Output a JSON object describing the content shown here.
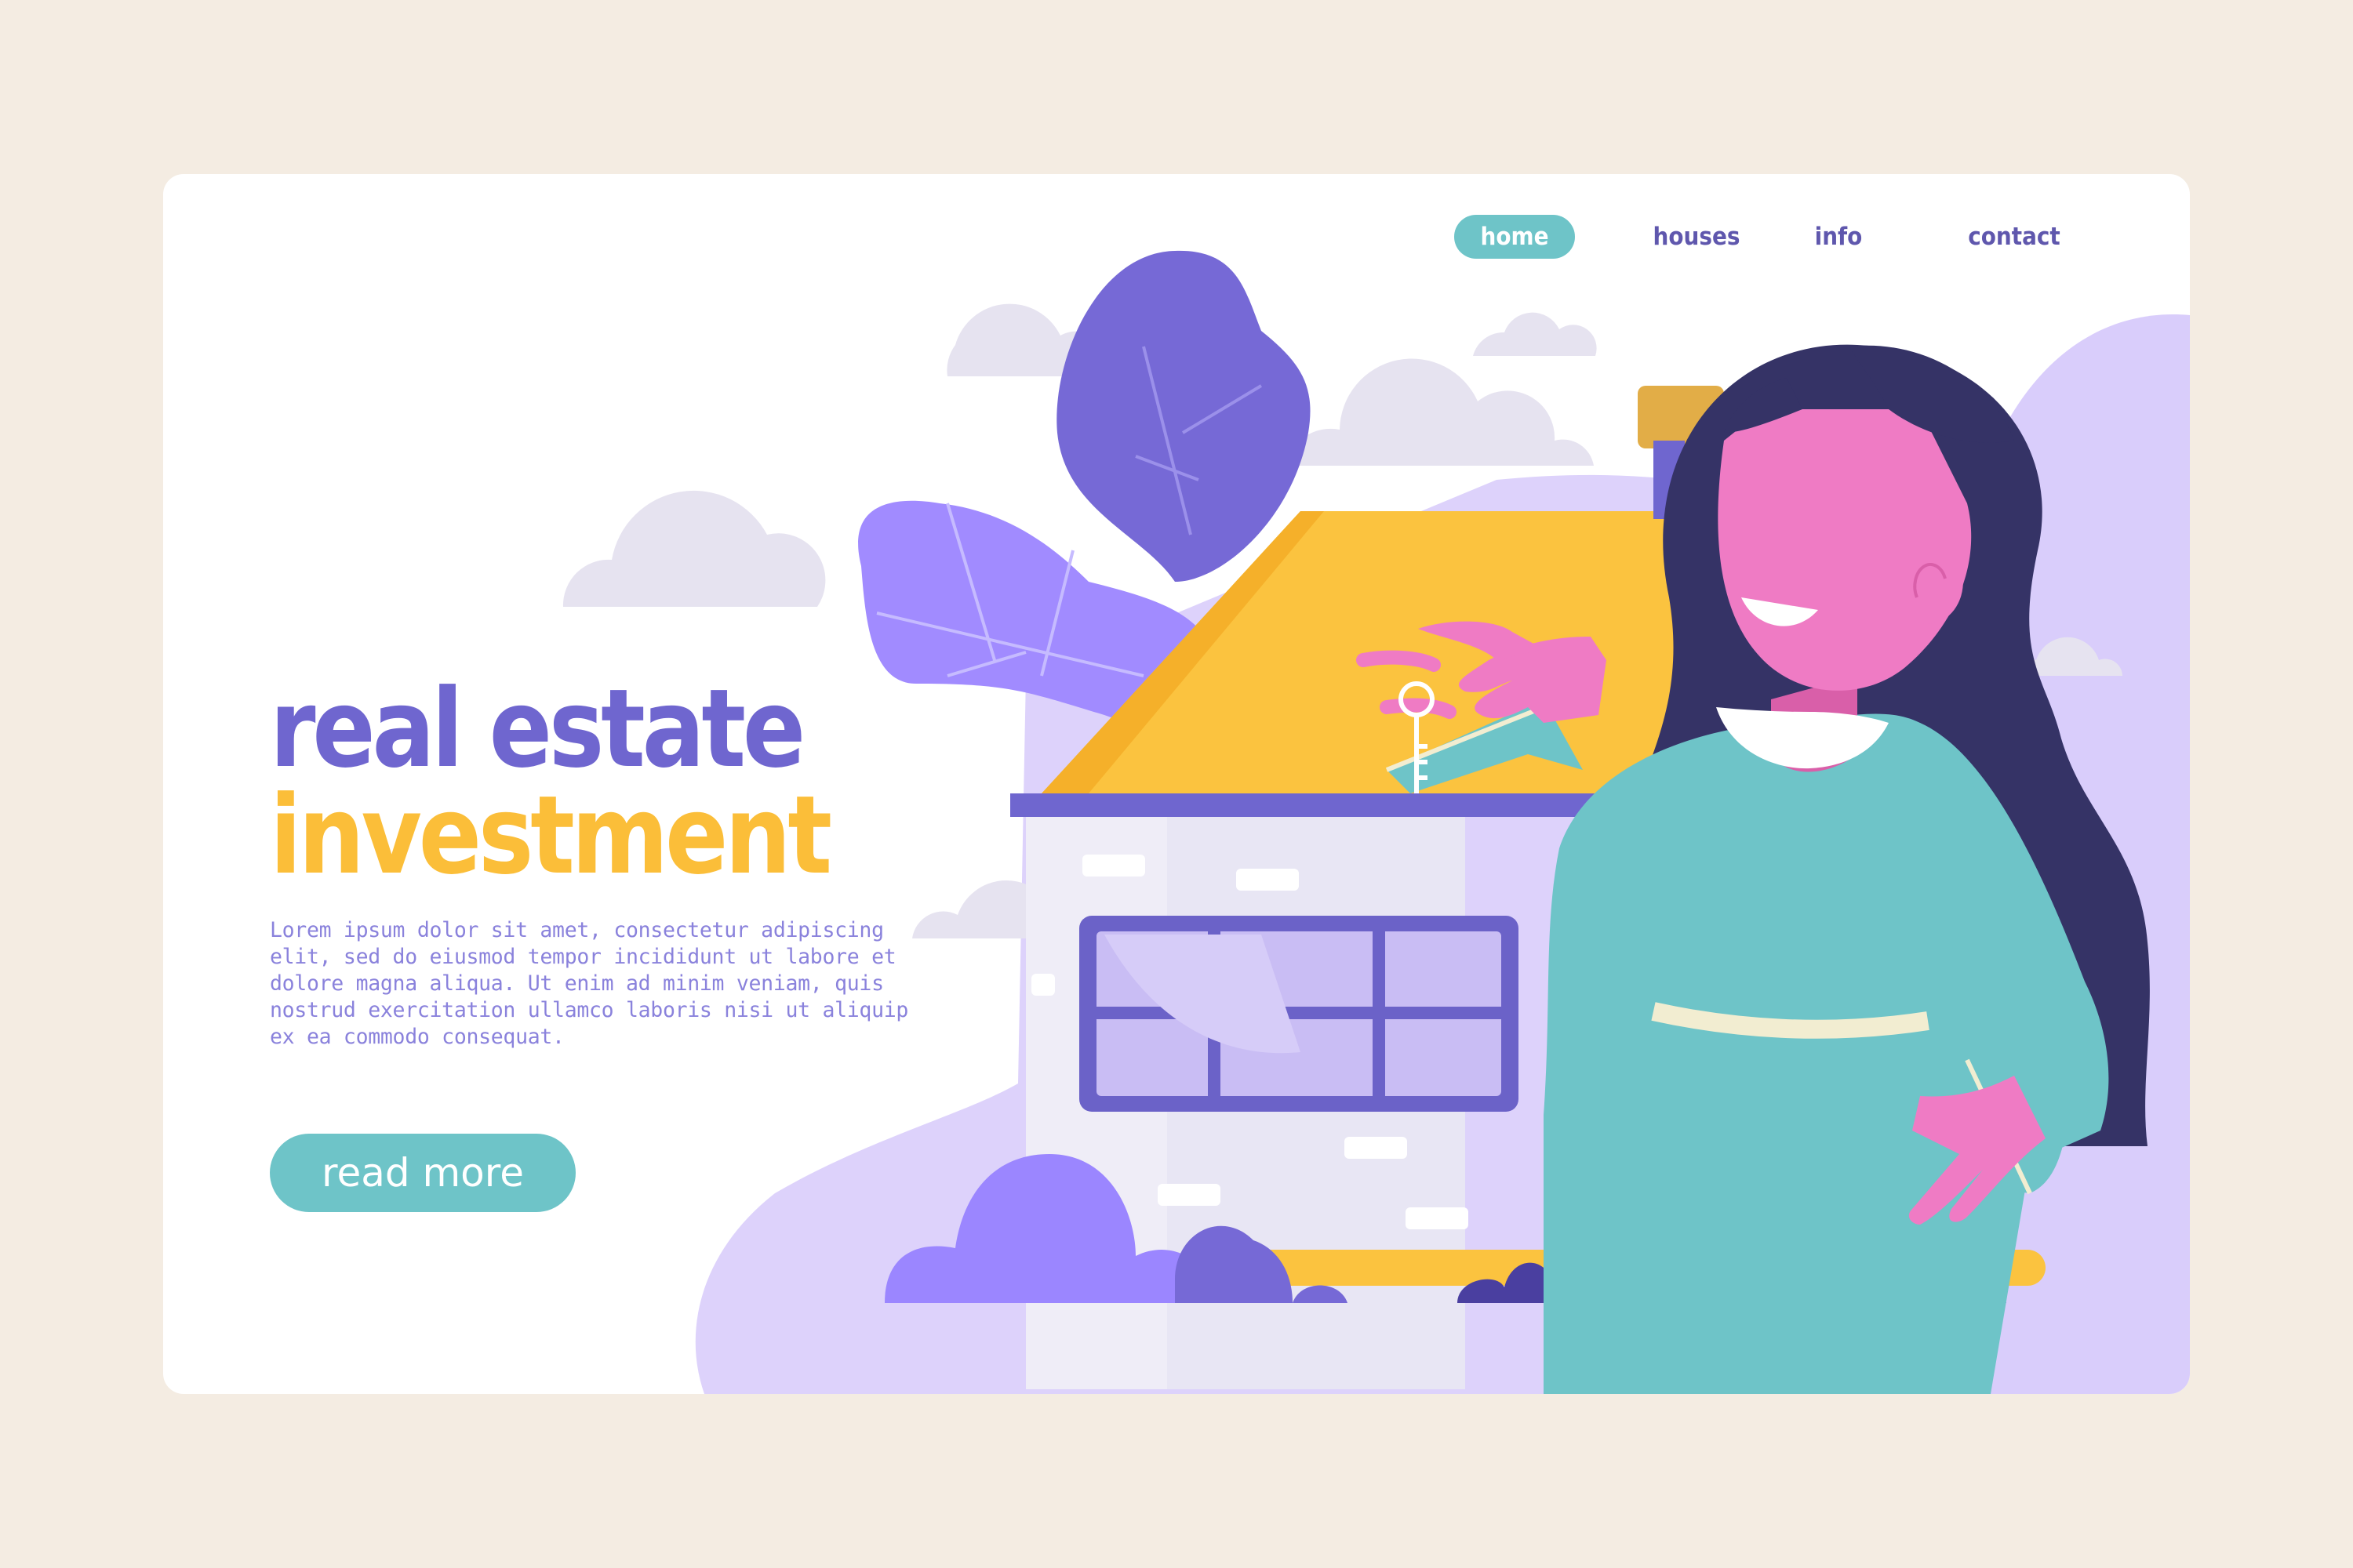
{
  "nav": {
    "items": [
      {
        "label": "home",
        "active": true
      },
      {
        "label": "houses",
        "active": false
      },
      {
        "label": "info",
        "active": false
      },
      {
        "label": "contact",
        "active": false
      }
    ]
  },
  "hero": {
    "title_line1": "real estate",
    "title_line2": "investment",
    "body": "Lorem ipsum dolor sit amet, consectetur adipiscing elit, sed do eiusmod tempor incididunt ut labore et dolore magna aliqua. Ut enim ad minim veniam, quis nostrud exercitation ullamco laboris nisi ut aliquip ex ea commodo consequat.",
    "button_label": "read more"
  },
  "illustration": {
    "icons": [
      "house-illustration",
      "woman-illustration",
      "key-icon",
      "leaf-illustration",
      "cloud-illustration",
      "bush-illustration"
    ]
  },
  "colors": {
    "page_background": "#f4ece2",
    "card_background": "#ffffff",
    "primary_purple": "#6f66cf",
    "accent_yellow": "#fbbe39",
    "teal": "#6ec4c8",
    "lavender": "#d9cdfb",
    "text_purple": "#8a82dc"
  }
}
